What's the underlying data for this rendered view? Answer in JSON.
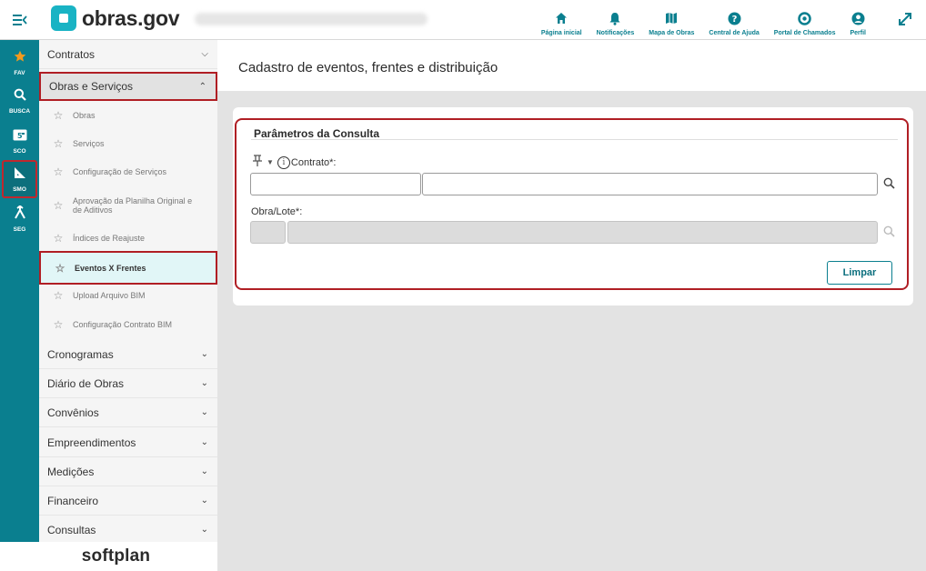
{
  "app": {
    "logo_text": "obras.gov",
    "menu_icon": "collapse-menu-icon",
    "expand_icon": "expand-arrows-icon"
  },
  "topnav": {
    "items": [
      {
        "label": "Página inicial",
        "icon": "home-icon"
      },
      {
        "label": "Notificações",
        "icon": "bell-icon"
      },
      {
        "label": "Mapa de Obras",
        "icon": "map-icon"
      },
      {
        "label": "Central de Ajuda",
        "icon": "help-icon"
      },
      {
        "label": "Portal de Chamados",
        "icon": "lifebuoy-icon"
      },
      {
        "label": "Perfil",
        "icon": "user-icon"
      }
    ]
  },
  "rail": {
    "items": [
      {
        "label": "FAV",
        "icon": "star-icon"
      },
      {
        "label": "BUSCA",
        "icon": "search-icon"
      },
      {
        "label": "SCO",
        "icon": "sco-icon"
      },
      {
        "label": "SMO",
        "icon": "ruler-triangle-icon"
      },
      {
        "label": "SEG",
        "icon": "merge-icon"
      }
    ]
  },
  "sidebar": {
    "groups": {
      "contratos": "Contratos",
      "obras_servicos": "Obras e Serviços",
      "cronogramas": "Cronogramas",
      "diario": "Diário de Obras",
      "convenios": "Convênios",
      "empreendimentos": "Empreendimentos",
      "medicoes": "Medições",
      "financeiro": "Financeiro",
      "consultas": "Consultas"
    },
    "subitems": {
      "obras": "Obras",
      "servicos": "Serviços",
      "config_servicos": "Configuração de Serviços",
      "aprovacao_l1": "Aprovação da Planilha Original e",
      "aprovacao_l2": "de Aditivos",
      "indices": "Índices de Reajuste",
      "eventos": "Eventos X Frentes",
      "upload_bim": "Upload Arquivo BIM",
      "config_bim": "Configuração Contrato BIM"
    },
    "footer": "softplan"
  },
  "main": {
    "page_title": "Cadastro de eventos, frentes e distribuição",
    "params_title": "Parâmetros da Consulta",
    "contrato_label": "Contrato*:",
    "obra_label": "Obra/Lote*:",
    "limpar_label": "Limpar",
    "contrato_code": "",
    "contrato_desc": "",
    "obra_code": "",
    "obra_desc": ""
  },
  "colors": {
    "brand": "#0a7f8f",
    "highlight_border": "#b01e24",
    "active_item_bg": "#e1f6f7"
  }
}
